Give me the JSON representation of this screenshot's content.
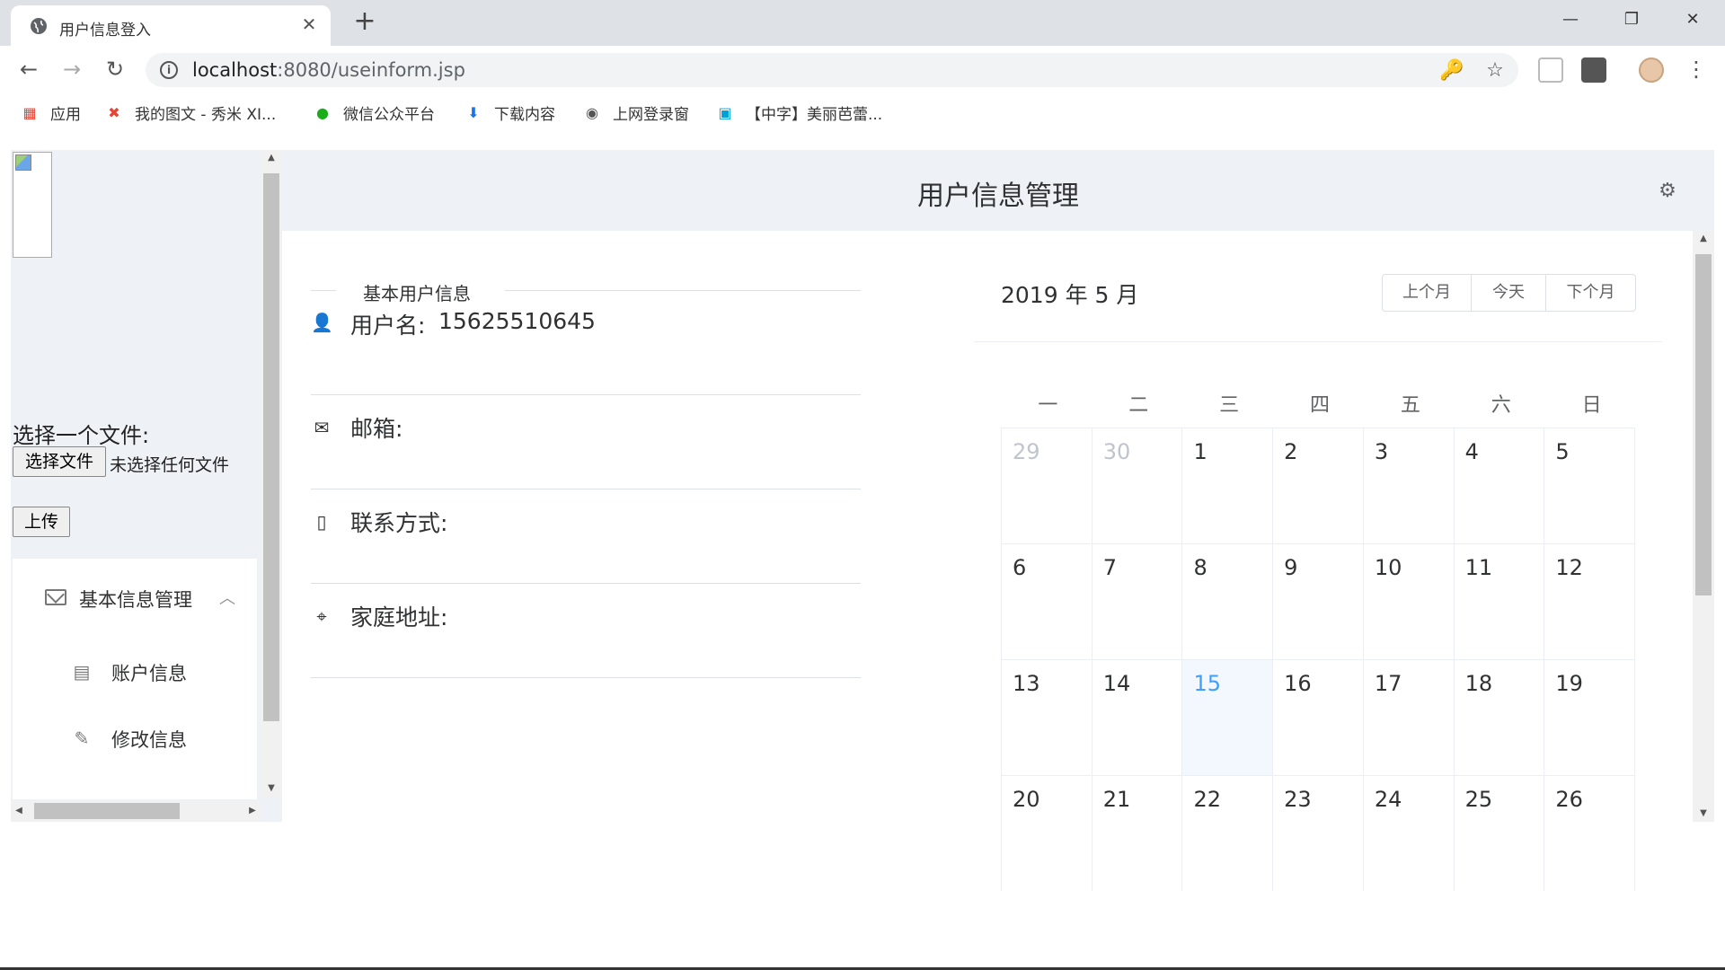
{
  "browser": {
    "tab_title": "用户信息登入",
    "tab_close": "✕",
    "new_tab": "+",
    "window": {
      "minimize": "—",
      "restore": "❐",
      "close": "✕"
    },
    "nav": {
      "back": "←",
      "forward": "→",
      "reload": "↻"
    },
    "url_host": "localhost",
    "url_rest": ":8080/useinform.jsp",
    "omni_icons": {
      "key": "🔑",
      "star": "☆"
    },
    "menu_dots": "⋮"
  },
  "bookmarks": [
    {
      "label": "应用",
      "icon": "apps-grid-icon",
      "glyph": "▦",
      "color": "#e94335"
    },
    {
      "label": "我的图文 - 秀米 XI...",
      "icon": "xiumi-icon",
      "glyph": "✖",
      "color": "#e94335"
    },
    {
      "label": "微信公众平台",
      "icon": "wechat-icon",
      "glyph": "●",
      "color": "#1aad19"
    },
    {
      "label": "下载内容",
      "icon": "download-icon",
      "glyph": "⬇",
      "color": "#1a73e8"
    },
    {
      "label": "上网登录窗",
      "icon": "globe-icon",
      "glyph": "◉",
      "color": "#555555"
    },
    {
      "label": "【中字】美丽芭蕾...",
      "icon": "bilibili-icon",
      "glyph": "▣",
      "color": "#00a1d6"
    }
  ],
  "sidebar": {
    "upload_label": "选择一个文件:",
    "file_button": "选择文件",
    "file_status": "未选择任何文件",
    "upload_button": "上传",
    "menu_group": "基本信息管理",
    "menu_arrow": "︿",
    "items": [
      {
        "label": "账户信息",
        "glyph": "▤"
      },
      {
        "label": "修改信息",
        "glyph": "✎"
      }
    ]
  },
  "header": {
    "title": "用户信息管理",
    "gear": "⚙"
  },
  "user_info": {
    "section_title": "基本用户信息",
    "rows": [
      {
        "key": "用户名:",
        "value": "15625510645",
        "glyph": "👤"
      },
      {
        "key": "邮箱:",
        "value": "",
        "glyph": "✉"
      },
      {
        "key": "联系方式:",
        "value": "",
        "glyph": "▯"
      },
      {
        "key": "家庭地址:",
        "value": "",
        "glyph": "⌖"
      }
    ]
  },
  "calendar": {
    "title": "2019 年 5 月",
    "buttons": [
      "上个月",
      "今天",
      "下个月"
    ],
    "weekdays": [
      "一",
      "二",
      "三",
      "四",
      "五",
      "六",
      "日"
    ],
    "today": "15",
    "weeks": [
      [
        "29",
        "30",
        "1",
        "2",
        "3",
        "4",
        "5"
      ],
      [
        "6",
        "7",
        "8",
        "9",
        "10",
        "11",
        "12"
      ],
      [
        "13",
        "14",
        "15",
        "16",
        "17",
        "18",
        "19"
      ],
      [
        "20",
        "21",
        "22",
        "23",
        "24",
        "25",
        "26"
      ]
    ],
    "prev_month_days": [
      "29",
      "30"
    ]
  },
  "colors": {
    "accent": "#409eff",
    "header_bg": "#eef1f6",
    "today_bg": "#f2f8fe"
  }
}
